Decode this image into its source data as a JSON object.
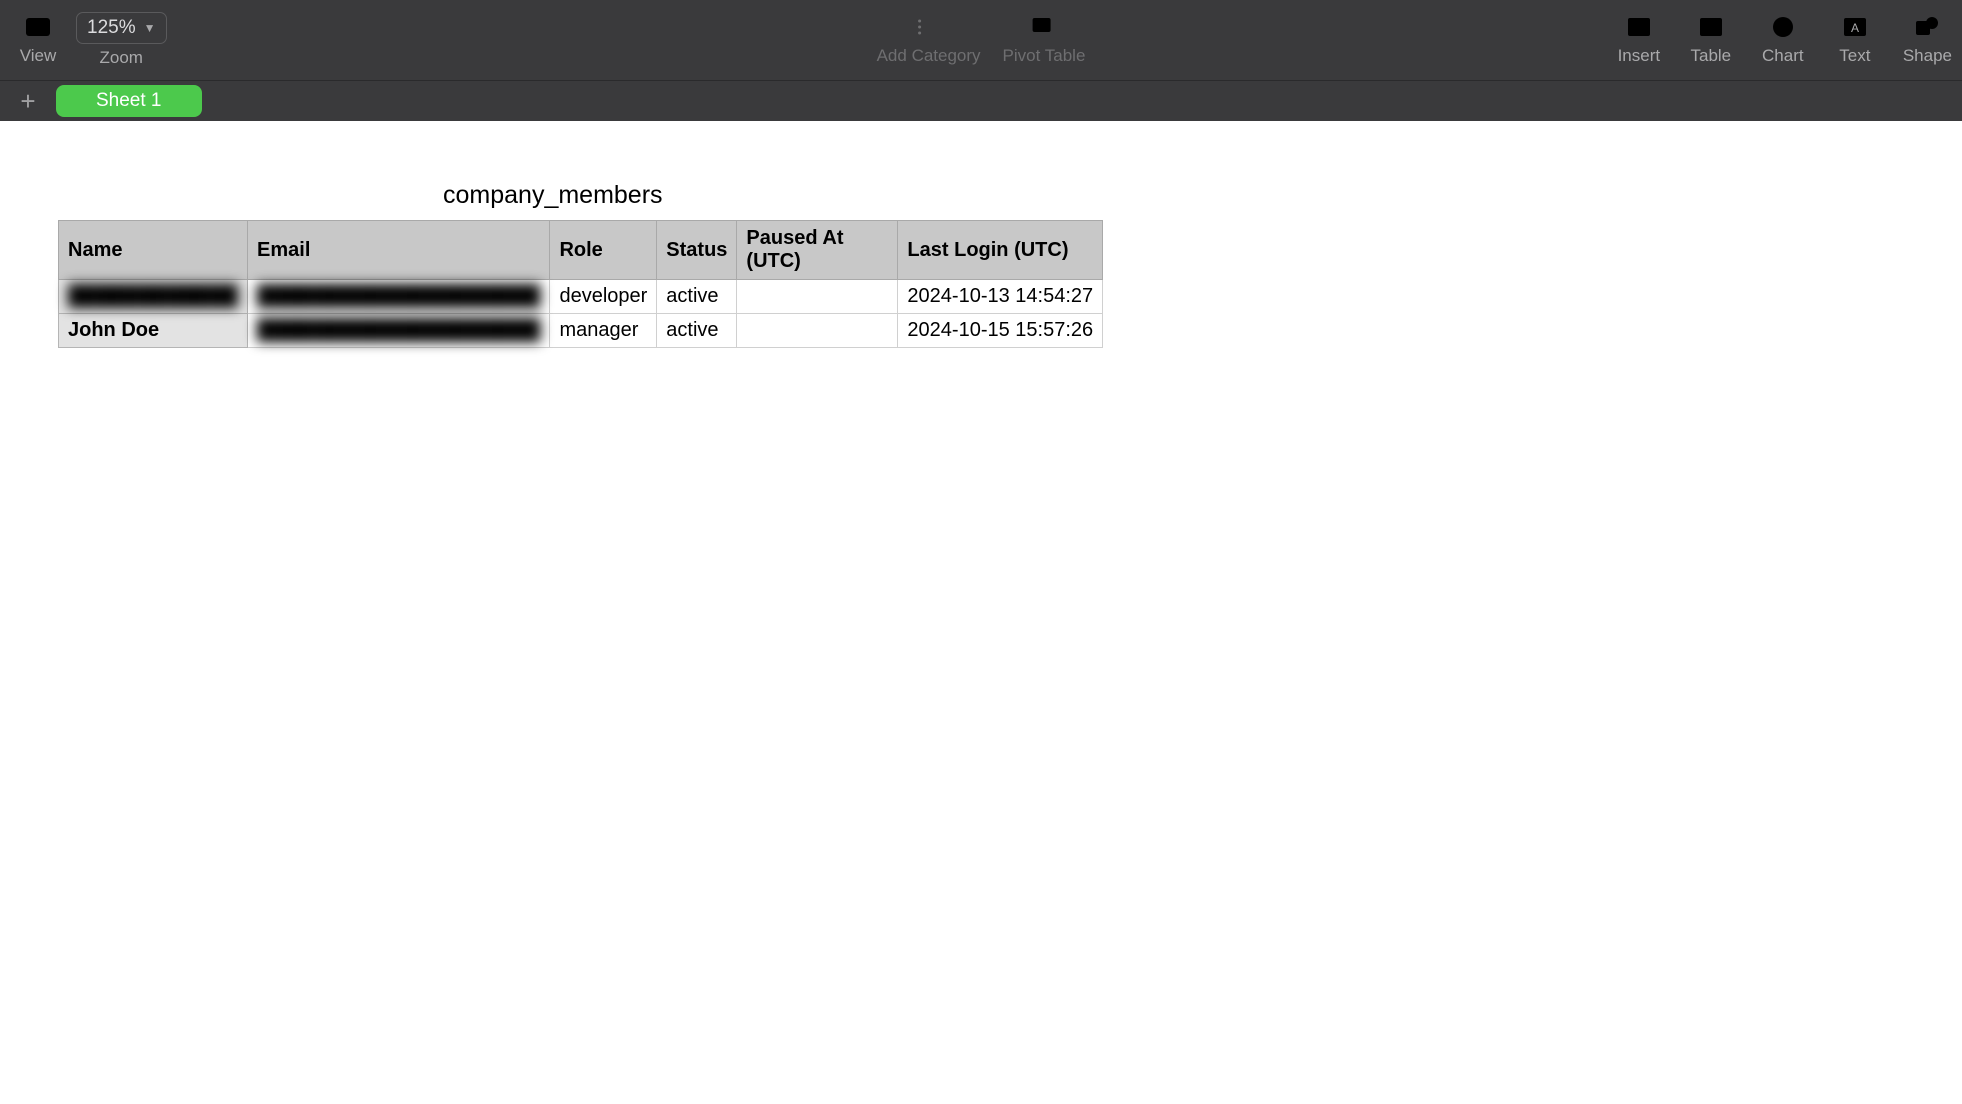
{
  "toolbar": {
    "view_label": "View",
    "zoom_label": "Zoom",
    "zoom_value": "125%",
    "add_category_label": "Add Category",
    "pivot_table_label": "Pivot Table",
    "insert_label": "Insert",
    "table_label": "Table",
    "chart_label": "Chart",
    "text_label": "Text",
    "shape_label": "Shape"
  },
  "sheets": {
    "active_tab": "Sheet 1"
  },
  "table": {
    "title": "company_members",
    "headers": {
      "name": "Name",
      "email": "Email",
      "role": "Role",
      "status": "Status",
      "paused_at": "Paused At (UTC)",
      "last_login": "Last Login (UTC)"
    },
    "rows": [
      {
        "name": "████████████",
        "email": "████████████████████",
        "role": "developer",
        "status": "active",
        "paused_at": "",
        "last_login": "2024-10-13 14:54:27",
        "name_blurred": true,
        "email_blurred": true
      },
      {
        "name": "John Doe",
        "email": "████████████████████",
        "role": "manager",
        "status": "active",
        "paused_at": "",
        "last_login": "2024-10-15 15:57:26",
        "name_blurred": false,
        "email_blurred": true
      }
    ]
  }
}
